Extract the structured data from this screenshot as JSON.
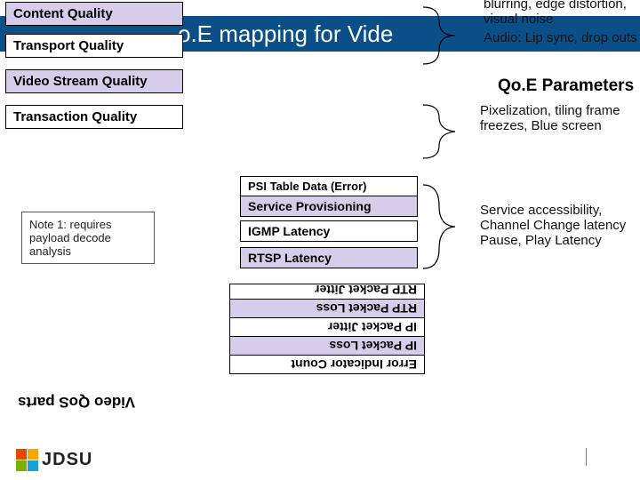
{
  "title_fragment": "o.E mapping for Vide",
  "quality_boxes": {
    "content": "Content Quality",
    "transport": "Transport Quality",
    "video_stream": "Video Stream Quality",
    "transaction": "Transaction Quality"
  },
  "note": "Note 1: requires payload decode analysis",
  "mid_boxes": {
    "psi": "PSI Table Data (Error)",
    "service_prov": "Service Provisioning",
    "igmp": "IGMP Latency",
    "rtsp": "RTSP Latency"
  },
  "flipped_boxes": {
    "rtp_jitter_cut": "RTP Packet Jitter",
    "rtp_loss": "RTP Packet Loss",
    "ip_jitter": "IP Packet Jitter",
    "ip_loss": "IP Packet Loss",
    "err_ind": "Error Indicator Count"
  },
  "right": {
    "top_cut": "blurring, edge distortion, visual noise",
    "audio": "Audio: Lip sync, drop outs",
    "header": "Qo.E Parameters",
    "pixel": "Pixelization, tiling frame freezes, Blue screen",
    "service": "Service accessibility, Channel Change latency Pause, Play Latency"
  },
  "bottom_left_label": "Video QoS parts",
  "logo_text": "JDSU",
  "colors": {
    "banner": "#0a4f87",
    "lavender": "#d7ccea"
  }
}
